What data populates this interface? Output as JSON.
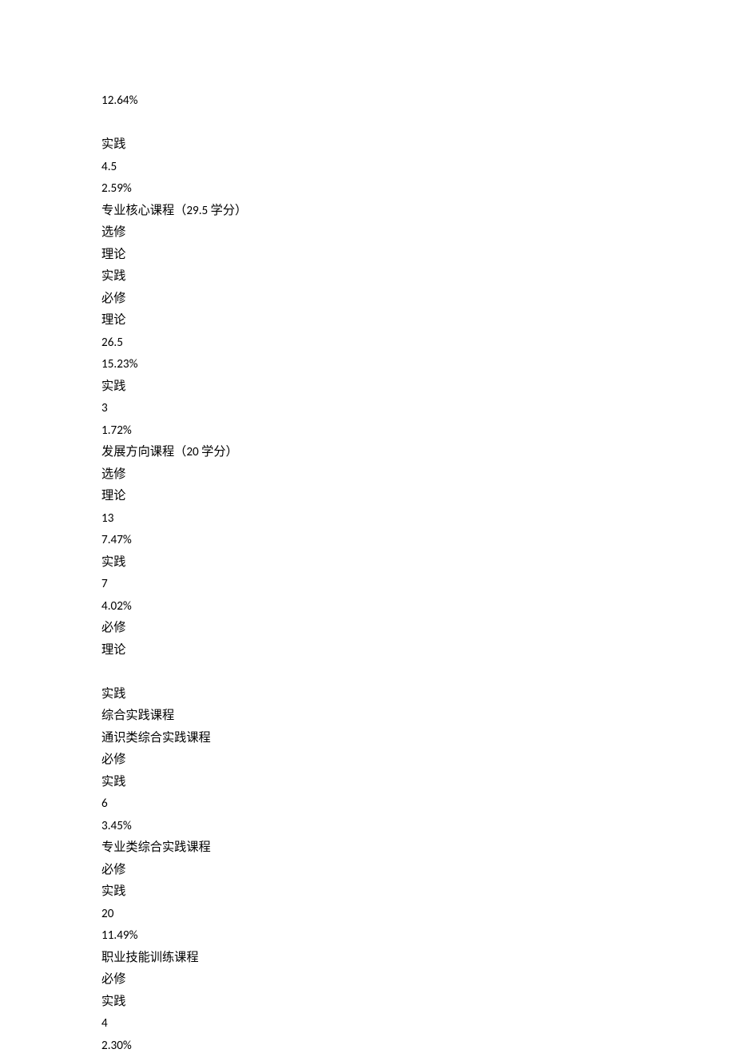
{
  "lines": [
    "12.64%",
    "",
    "实践",
    "4.5",
    "2.59%",
    "专业核心课程（29.5 学分）",
    "选修",
    "理论",
    "实践",
    "必修",
    "理论",
    "26.5",
    "15.23%",
    "实践",
    "3",
    "1.72%",
    "发展方向课程（20 学分）",
    "选修",
    "理论",
    "13",
    "7.47%",
    "实践",
    "7",
    "4.02%",
    "必修",
    "理论",
    "",
    "实践",
    "综合实践课程",
    "通识类综合实践课程",
    "必修",
    "实践",
    "6",
    "3.45%",
    "专业类综合实践课程",
    "必修",
    "实践",
    "20",
    "11.49%",
    "职业技能训练课程",
    "必修",
    "实践",
    "4",
    "2.30%"
  ]
}
